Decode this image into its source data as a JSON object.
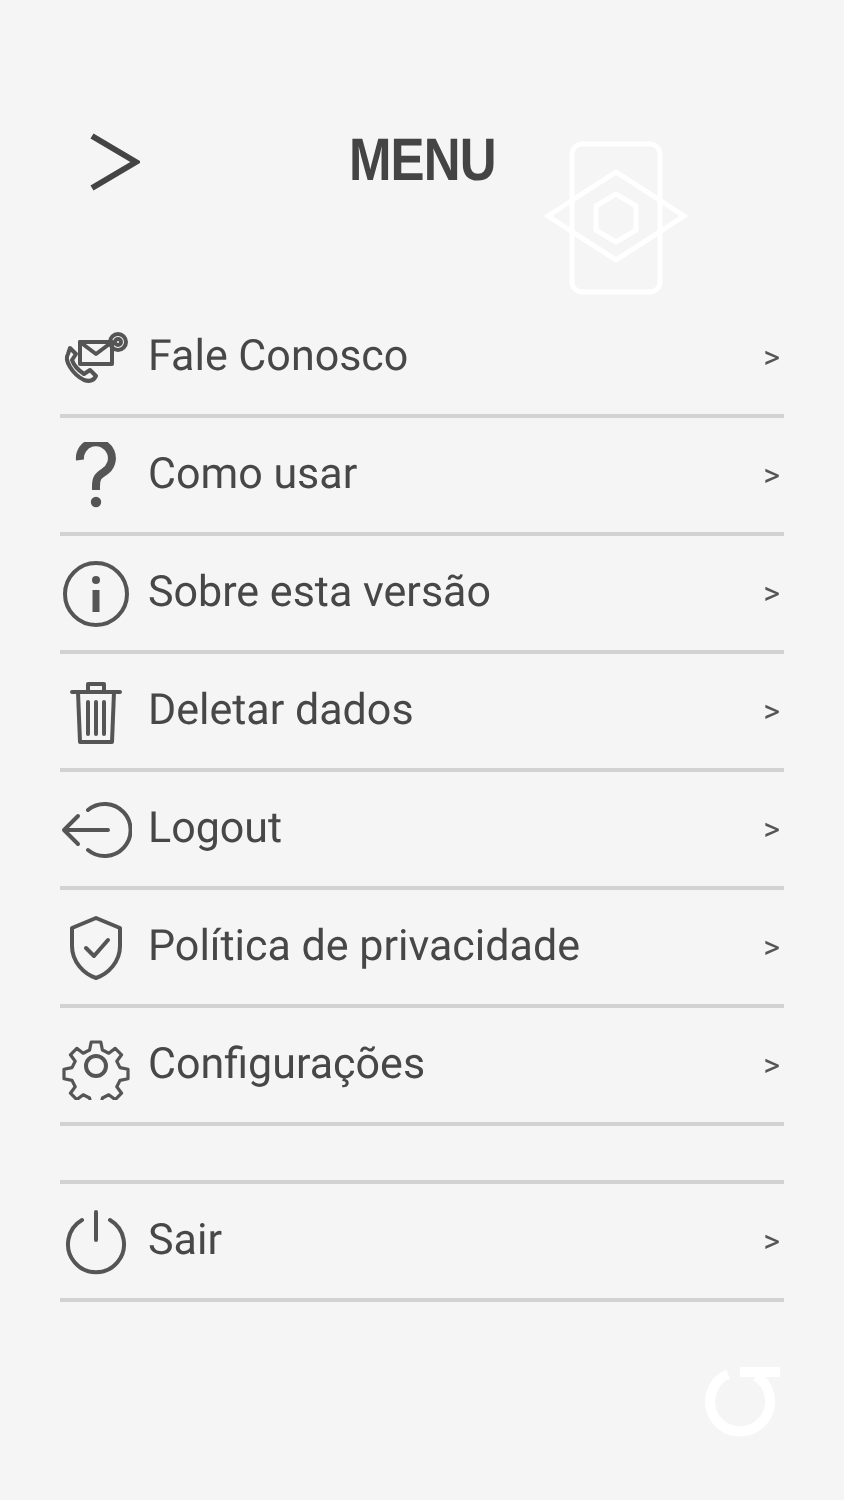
{
  "header": {
    "title": "MENU"
  },
  "items": [
    {
      "kind": "contact",
      "label": "Fale Conosco",
      "chevron": ">"
    },
    {
      "kind": "help",
      "label": "Como usar",
      "chevron": ">"
    },
    {
      "kind": "info",
      "label": "Sobre esta versão",
      "chevron": ">"
    },
    {
      "kind": "trash",
      "label": "Deletar dados",
      "chevron": ">"
    },
    {
      "kind": "logout",
      "label": "Logout",
      "chevron": ">"
    },
    {
      "kind": "shield",
      "label": "Política de privacidade",
      "chevron": ">"
    },
    {
      "kind": "gear",
      "label": "Configurações",
      "chevron": ">"
    },
    {
      "kind": "spacer"
    },
    {
      "kind": "power",
      "label": "Sair",
      "chevron": ">"
    }
  ]
}
